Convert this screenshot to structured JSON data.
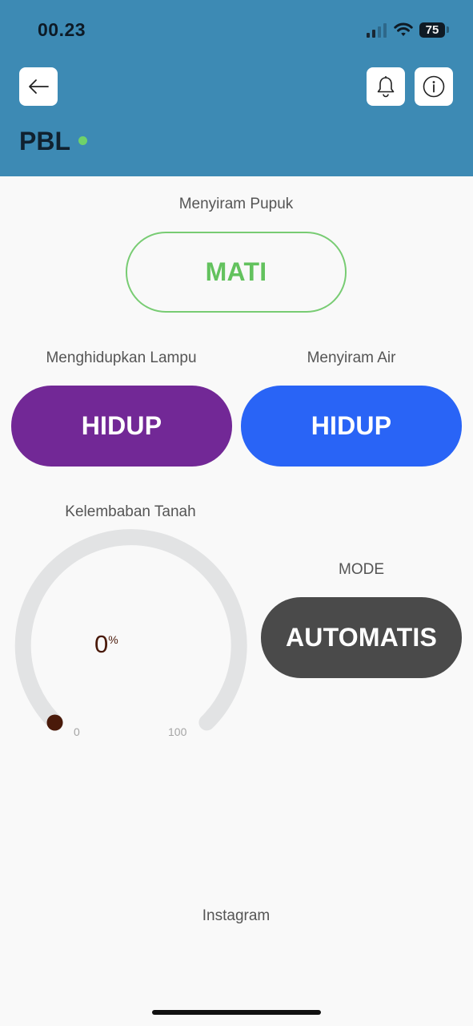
{
  "status_bar": {
    "time": "00.23",
    "battery": "75",
    "signal_icon": "cellular-signal-icon",
    "wifi_icon": "wifi-icon"
  },
  "header": {
    "title": "PBL",
    "back_icon": "arrow-left-icon",
    "bell_icon": "bell-icon",
    "info_icon": "info-icon",
    "online_color": "#6fd26a",
    "background": "#3d8ab4"
  },
  "controls": {
    "fertilizer": {
      "label": "Menyiram Pupuk",
      "state": "MATI",
      "color": "#63c25e"
    },
    "lamp": {
      "label": "Menghidupkan Lampu",
      "state": "HIDUP",
      "color": "#722896"
    },
    "water": {
      "label": "Menyiram Air",
      "state": "HIDUP",
      "color": "#2964f6"
    },
    "mode": {
      "label": "MODE",
      "state": "AUTOMATIS",
      "color": "#4a4a4a"
    }
  },
  "gauge": {
    "label": "Kelembaban Tanah",
    "value": "0",
    "unit": "%",
    "min": "0",
    "max": "100",
    "level": 0
  },
  "footer": {
    "link": "Instagram"
  }
}
